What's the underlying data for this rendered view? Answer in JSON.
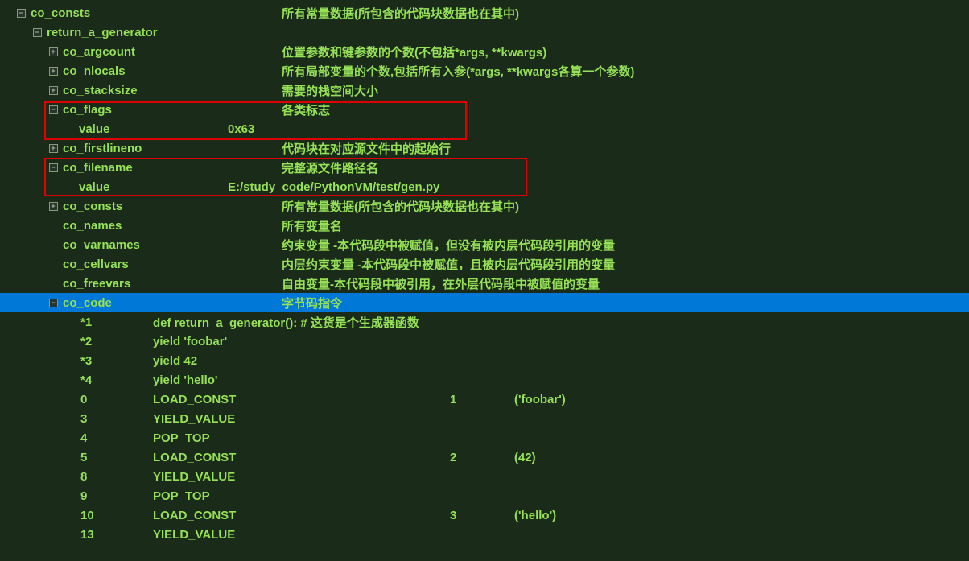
{
  "tree": {
    "co_consts_root": {
      "label": "co_consts",
      "desc": "所有常量数据(所包含的代码块数据也在其中)"
    },
    "return_a_generator": {
      "label": "return_a_generator"
    },
    "co_argcount": {
      "label": "co_argcount",
      "desc": "位置参数和键参数的个数(不包括*args, **kwargs)"
    },
    "co_nlocals": {
      "label": "co_nlocals",
      "desc": "所有局部变量的个数,包括所有入参(*args, **kwargs各算一个参数)"
    },
    "co_stacksize": {
      "label": "co_stacksize",
      "desc": "需要的栈空间大小"
    },
    "co_flags": {
      "label": "co_flags",
      "desc": "各类标志"
    },
    "co_flags_value": {
      "label": "value",
      "val": "0x63"
    },
    "co_firstlineno": {
      "label": "co_firstlineno",
      "desc": "代码块在对应源文件中的起始行"
    },
    "co_filename": {
      "label": "co_filename",
      "desc": "完整源文件路径名"
    },
    "co_filename_value": {
      "label": "value",
      "val": "E:/study_code/PythonVM/test/gen.py"
    },
    "co_consts": {
      "label": "co_consts",
      "desc": "所有常量数据(所包含的代码块数据也在其中)"
    },
    "co_names": {
      "label": "co_names",
      "desc": "所有变量名"
    },
    "co_varnames": {
      "label": "co_varnames",
      "desc": "约束变量 -本代码段中被赋值，但没有被内层代码段引用的变量"
    },
    "co_cellvars": {
      "label": "co_cellvars",
      "desc": "内层约束变量 -本代码段中被赋值，且被内层代码段引用的变量"
    },
    "co_freevars": {
      "label": "co_freevars",
      "desc": "自由变量-本代码段中被引用，在外层代码段中被赋值的变量"
    },
    "co_code": {
      "label": "co_code",
      "desc": "字节码指令"
    }
  },
  "source": [
    {
      "lineno": "*1",
      "text": "def return_a_generator():  # 这货是个生成器函数"
    },
    {
      "lineno": "*2",
      "text": "    yield 'foobar'"
    },
    {
      "lineno": "*3",
      "text": "    yield 42"
    },
    {
      "lineno": "*4",
      "text": "    yield 'hello'"
    }
  ],
  "bytecode": [
    {
      "offset": "0",
      "instr": "LOAD_CONST",
      "arg": "1",
      "argval": "('foobar')"
    },
    {
      "offset": "3",
      "instr": "YIELD_VALUE",
      "arg": "",
      "argval": ""
    },
    {
      "offset": "4",
      "instr": "POP_TOP",
      "arg": "",
      "argval": ""
    },
    {
      "offset": "5",
      "instr": "LOAD_CONST",
      "arg": "2",
      "argval": "(42)"
    },
    {
      "offset": "8",
      "instr": "YIELD_VALUE",
      "arg": "",
      "argval": ""
    },
    {
      "offset": "9",
      "instr": "POP_TOP",
      "arg": "",
      "argval": ""
    },
    {
      "offset": "10",
      "instr": "LOAD_CONST",
      "arg": "3",
      "argval": "('hello')"
    },
    {
      "offset": "13",
      "instr": "YIELD_VALUE",
      "arg": "",
      "argval": ""
    }
  ],
  "icons": {
    "plus": "+",
    "minus": "−"
  }
}
